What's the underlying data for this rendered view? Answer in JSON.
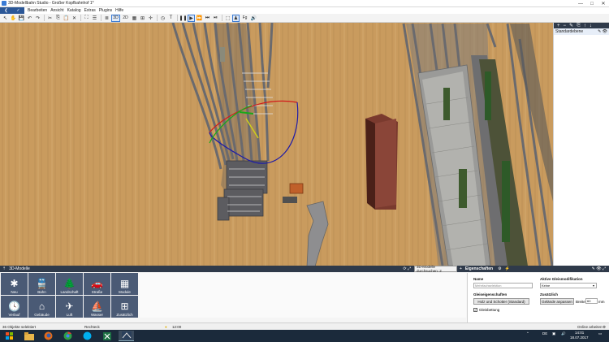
{
  "window": {
    "title": "3D-Modellbahn Studio - Großer Kopfbahnhof 1*",
    "minimize": "—",
    "maximize": "□",
    "close": "✕"
  },
  "menu": {
    "items": [
      "Bearbeiten",
      "Ansicht",
      "Katalog",
      "Extras",
      "Plugins",
      "Hilfe"
    ]
  },
  "toolbar": {
    "view_3d": "3D",
    "view_2d": "2D",
    "fps": "Fg"
  },
  "right_panel": {
    "layer_name": "Standardebene"
  },
  "models_panel": {
    "title": "3D-Modelle",
    "browse_tab": "3D-Modelle durchsuchen: 2",
    "categories": [
      {
        "label": "Neu",
        "icon": "star-icon",
        "glyph": "✱"
      },
      {
        "label": "Bahn",
        "icon": "train-icon",
        "glyph": "🚆"
      },
      {
        "label": "Landschaft",
        "icon": "tree-icon",
        "glyph": "🌲"
      },
      {
        "label": "Straße",
        "icon": "car-icon",
        "glyph": "🚗"
      },
      {
        "label": "Module",
        "icon": "grid-icon",
        "glyph": "▦"
      },
      {
        "label": "Verlauf",
        "icon": "clock-icon",
        "glyph": "🕓"
      },
      {
        "label": "Gebäude",
        "icon": "house-icon",
        "glyph": "⌂"
      },
      {
        "label": "Luft",
        "icon": "plane-icon",
        "glyph": "✈"
      },
      {
        "label": "Wasser",
        "icon": "sailboat-icon",
        "glyph": "⛵"
      },
      {
        "label": "Zusätzlich",
        "icon": "add-icon",
        "glyph": "⊞"
      }
    ]
  },
  "properties": {
    "title": "Eigenschaften",
    "name_label": "Name",
    "name_placeholder": "Mehrfachselektion",
    "active_mod_label": "Aktive Gleismodifikation",
    "active_mod_value": "Keine",
    "track_props_label": "Gleiseigenschaften",
    "track_props_button": "Holz und Schotter (Standard)",
    "edit_label": "Zusätzlich",
    "terrain_button": "Gelände anpassen",
    "width_label": "Breite:",
    "width_value": "60",
    "width_unit": "mm",
    "bedding_label": "Gleisbettung",
    "bedding_checked": true
  },
  "status": {
    "selection": "36 Objekte selektiert",
    "tool": "Rechteck",
    "time": "12:00",
    "mode": "Online arbeiten"
  },
  "taskbar": {
    "lang": "DE",
    "clock_time": "14:01",
    "clock_date": "18.07.2017"
  }
}
